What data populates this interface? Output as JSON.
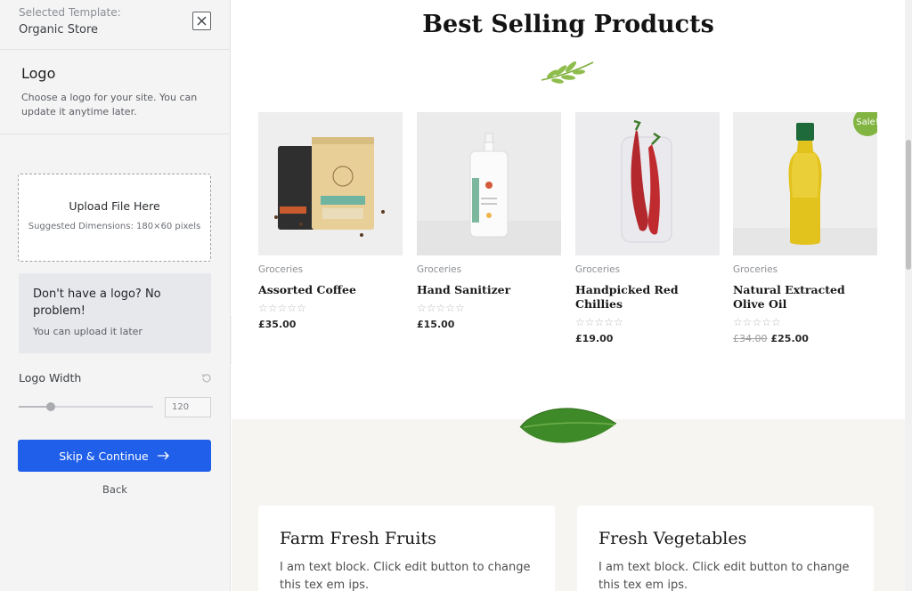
{
  "sidebar": {
    "selected_label": "Selected Template:",
    "selected_value": "Organic Store",
    "logo_title": "Logo",
    "logo_description": "Choose a logo for your site. You can update it anytime later.",
    "upload_title": "Upload File Here",
    "upload_hint": "Suggested Dimensions: 180×60 pixels",
    "no_logo_title": "Don't have a logo? No problem!",
    "no_logo_sub": "You can upload it later",
    "logo_width_label": "Logo Width",
    "logo_width_value": "120",
    "logo_width_slider_fraction": 0.24,
    "skip_button": "Skip & Continue",
    "back_link": "Back",
    "accent_color": "#1f5fea"
  },
  "preview": {
    "section_title": "Best Selling Products",
    "products": [
      {
        "category": "Groceries",
        "name": "Assorted Coffee",
        "rating": "☆☆☆☆☆",
        "price": "£35.00",
        "old_price": "",
        "badge": ""
      },
      {
        "category": "Groceries",
        "name": "Hand Sanitizer",
        "rating": "☆☆☆☆☆",
        "price": "£15.00",
        "old_price": "",
        "badge": ""
      },
      {
        "category": "Groceries",
        "name": "Handpicked Red Chillies",
        "rating": "☆☆☆☆☆",
        "price": "£19.00",
        "old_price": "",
        "badge": ""
      },
      {
        "category": "Groceries",
        "name": "Natural Extracted Olive Oil",
        "rating": "☆☆☆☆☆",
        "price": "£25.00",
        "old_price": "£34.00",
        "badge": "Sale!"
      }
    ],
    "info_cards": [
      {
        "title": "Farm Fresh Fruits",
        "text": "I am text block. Click edit button to change this tex em ips."
      },
      {
        "title": "Fresh Vegetables",
        "text": "I am text block. Click edit button to change this tex em ips."
      }
    ],
    "sale_color": "#81b441"
  }
}
